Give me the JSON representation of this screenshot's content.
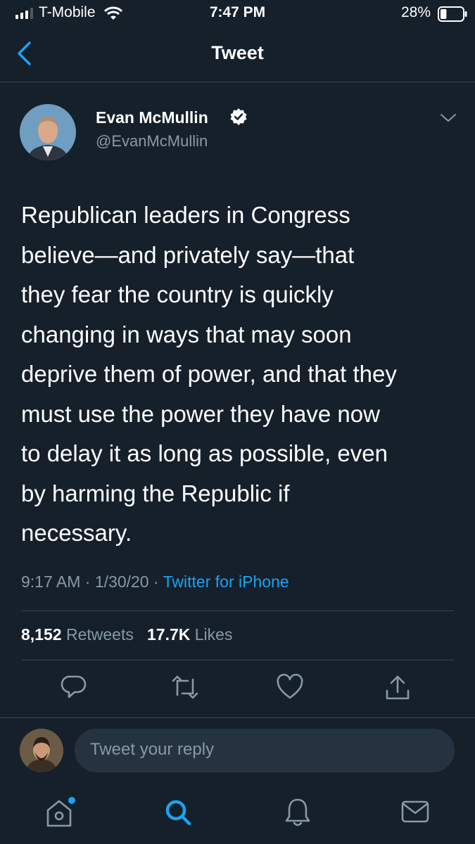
{
  "status_bar": {
    "carrier": "T-Mobile",
    "time": "7:47 PM",
    "battery_percent": "28%",
    "battery_level": 0.28,
    "icons": [
      "signal-icon",
      "wifi-icon",
      "battery-icon"
    ]
  },
  "nav": {
    "title": "Tweet",
    "back_icon": "chevron-left-icon"
  },
  "tweet": {
    "author_name": "Evan McMullin",
    "author_handle": "@EvanMcMullin",
    "verified": true,
    "text": "Republican leaders in Congress\nbelieve—and privately say—that\nthey fear the country is quickly\nchanging in ways that may soon\ndeprive them of power, and that they\nmust use the power they have now\nto delay it as long as possible, even\nby harming the Republic if\nnecessary.",
    "time": "9:17 AM",
    "date": "1/30/20",
    "separator": "·",
    "source": "Twitter for iPhone",
    "retweets_count": "8,152",
    "retweets_label": "Retweets",
    "likes_count": "17.7K",
    "likes_label": "Likes"
  },
  "actions": [
    "reply-icon",
    "retweet-icon",
    "like-icon",
    "share-icon"
  ],
  "reply": {
    "placeholder": "Tweet your reply"
  },
  "tab_bar": [
    "home-icon",
    "search-icon",
    "notifications-icon",
    "messages-icon"
  ],
  "colors": {
    "background": "#15202b",
    "accent": "#1da1f2",
    "secondary_text": "#8899a6",
    "divider": "#38444d"
  }
}
